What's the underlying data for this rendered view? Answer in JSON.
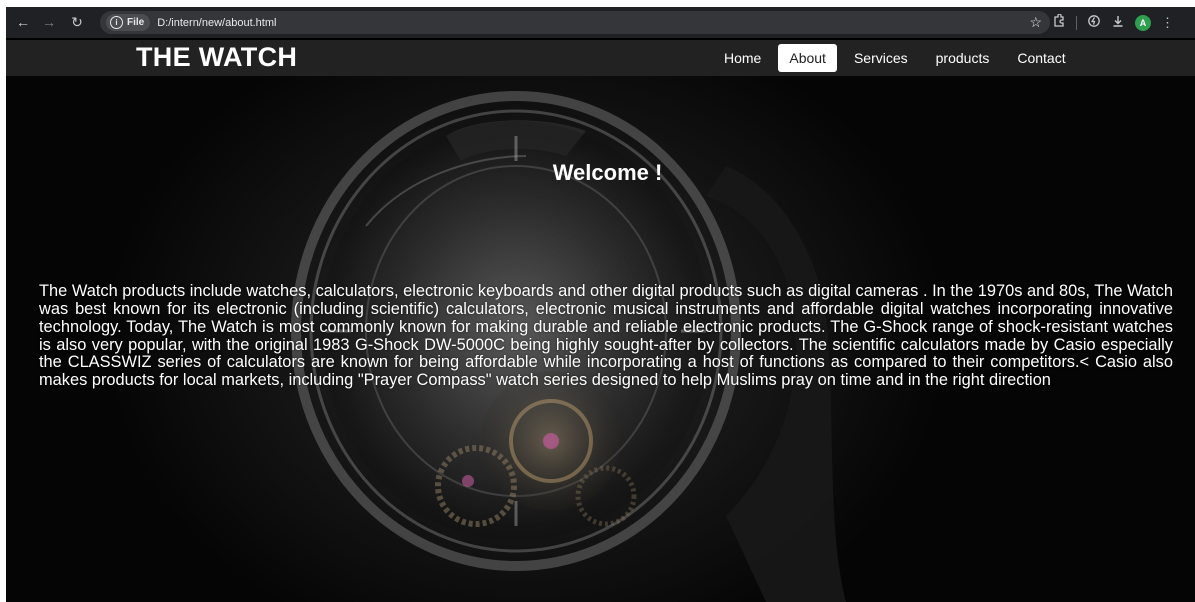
{
  "browser": {
    "back_icon": "back-arrow-icon",
    "forward_icon": "forward-arrow-icon",
    "reload_icon": "reload-icon",
    "file_chip_label": "File",
    "url": "D:/intern/new/about.html",
    "avatar_letter": "A"
  },
  "site": {
    "logo": "THE WATCH",
    "nav": [
      {
        "label": "Home",
        "active": false
      },
      {
        "label": "About",
        "active": true
      },
      {
        "label": "Services",
        "active": false
      },
      {
        "label": "products",
        "active": false
      },
      {
        "label": "Contact",
        "active": false
      }
    ]
  },
  "hero": {
    "heading": "Welcome !",
    "paragraph": "The Watch products include watches, calculators, electronic keyboards and other digital products such as digital cameras . In the 1970s and 80s, The Watch was best known for its electronic (including scientific) calculators, electronic musical instruments and affordable digital watches incorporating innovative technology. Today, The Watch is most commonly known for making durable and reliable electronic products. The G-Shock range of shock-resistant watches is also very popular, with the original 1983 G-Shock DW-5000C being highly sought-after by collectors. The scientific calculators made by Casio especially the CLASSWIZ series of calculators are known for being affordable while incorporating a host of functions as compared to their competitors.< Casio also makes products for local markets, including \"Prayer Compass\" watch series designed to help Muslims pray on time and in the right direction"
  },
  "colors": {
    "header_bg": "#222222",
    "nav_active_bg": "#ffffff",
    "text": "#ffffff",
    "browser_bg": "#202124"
  }
}
